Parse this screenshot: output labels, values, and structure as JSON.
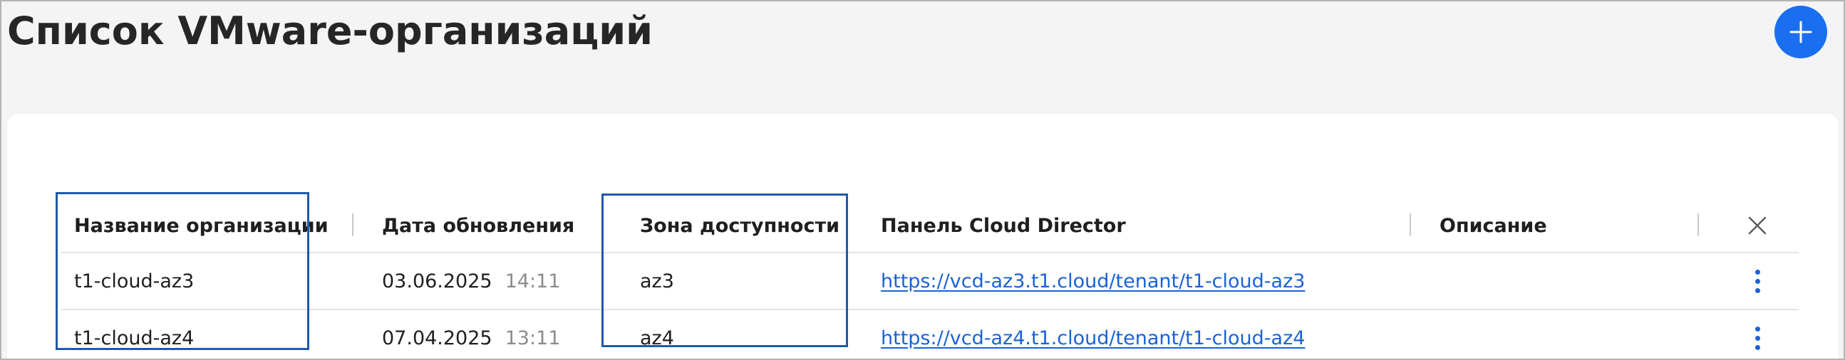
{
  "page": {
    "title": "Список VMware-организаций"
  },
  "toolbar": {
    "add_icon": "plus-icon",
    "accent_color": "#1a6ef0"
  },
  "table": {
    "columns": {
      "name": "Название организации",
      "date": "Дата обновления",
      "zone": "Зона доступности",
      "panel": "Панель Cloud Director",
      "description": "Описание"
    },
    "close_icon": "close-icon",
    "rows": [
      {
        "name": "t1-cloud-az3",
        "date": "03.06.2025",
        "time": "14:11",
        "zone": "az3",
        "panel_url": "https://vcd-az3.t1.cloud/tenant/t1-cloud-az3",
        "description": ""
      },
      {
        "name": "t1-cloud-az4",
        "date": "07.04.2025",
        "time": "13:11",
        "zone": "az4",
        "panel_url": "https://vcd-az4.t1.cloud/tenant/t1-cloud-az4",
        "description": ""
      }
    ]
  },
  "colors": {
    "link": "#1a62d6",
    "highlight_border": "#1e5aa8"
  }
}
